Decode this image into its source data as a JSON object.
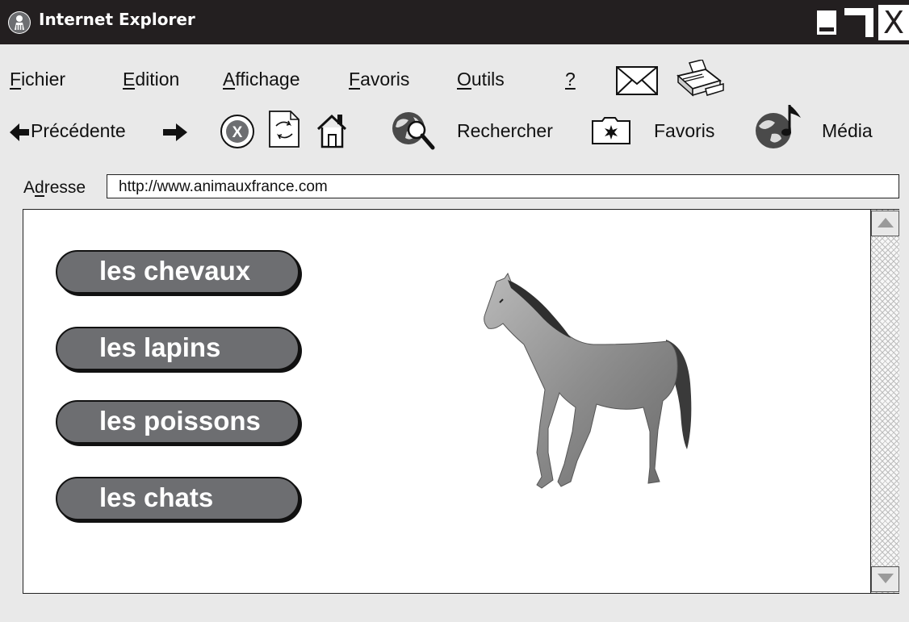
{
  "window": {
    "title": "Internet Explorer",
    "close_glyph": "X"
  },
  "menu": [
    {
      "first": "F",
      "rest": "ichier"
    },
    {
      "first": "E",
      "rest": "dition"
    },
    {
      "first": "A",
      "rest": "ffichage"
    },
    {
      "first": "F",
      "rest": "avoris"
    },
    {
      "first": "O",
      "rest": "utils"
    },
    {
      "label": "?"
    }
  ],
  "toolbar": {
    "back_label": "Précédente",
    "search_label": "Rechercher",
    "favorites_label": "Favoris",
    "media_label": "Média",
    "stop_glyph": "X",
    "icons": [
      "mail-icon",
      "printer-icon",
      "back-arrow-icon",
      "forward-arrow-icon",
      "stop-icon",
      "refresh-icon",
      "home-icon",
      "search-globe-icon",
      "favorites-folder-icon",
      "media-globe-icon"
    ]
  },
  "address": {
    "label_pre": "A",
    "label_key": "d",
    "label_post": "resse",
    "url": "http://www.animauxfrance.com"
  },
  "content": {
    "nav": [
      "les chevaux",
      "les lapins",
      "les poissons",
      "les chats"
    ],
    "image": "horse-image"
  },
  "colors": {
    "titlebar": "#231f20",
    "button": "#6d6e71",
    "chrome": "#e9e9e9"
  }
}
